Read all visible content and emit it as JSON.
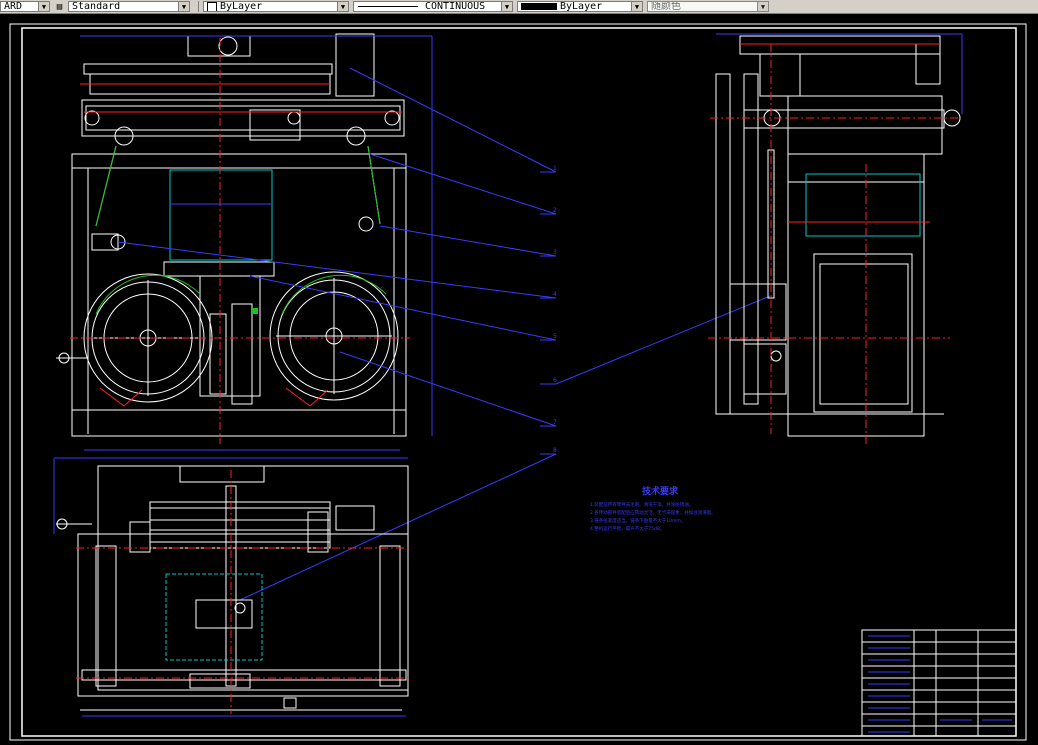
{
  "toolbar": {
    "style_partial": "ARD",
    "text_style": "Standard",
    "layer_color": "ByLayer",
    "linetype": "CONTINUOUS",
    "lineweight": "ByLayer",
    "plot_style": "随颜色"
  },
  "drawing": {
    "tech_req_title": "技术要求",
    "tech_req_lines": [
      "1.装配前所有零件去毛刺、清洗干净，并涂防锈油。",
      "2.各传动部件装配后应转动灵活，无卡滞现象，并加注润滑脂。",
      "3.链条张紧度适当，链条下垂量不大于10mm。",
      "4.整机运行平稳，噪声不大于75dB。"
    ],
    "callouts": [
      "1",
      "2",
      "3",
      "4",
      "5",
      "6",
      "7",
      "8"
    ],
    "colors": {
      "background": "#000000",
      "frame": "#ffffff",
      "blue": "#3a3aff",
      "red": "#ff2020",
      "green": "#20c020",
      "cyan": "#00c8c8"
    }
  }
}
